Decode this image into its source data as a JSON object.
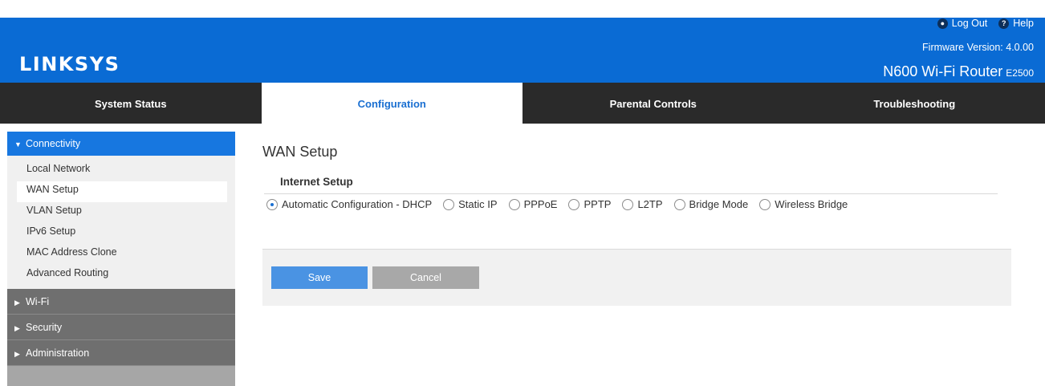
{
  "header": {
    "logo": "LINKSYS",
    "logout_label": "Log Out",
    "help_label": "Help",
    "firmware": "Firmware Version: 4.0.00",
    "model_name": "N600 Wi-Fi Router",
    "model_code": "E2500"
  },
  "tabs": [
    {
      "label": "System Status"
    },
    {
      "label": "Configuration"
    },
    {
      "label": "Parental Controls"
    },
    {
      "label": "Troubleshooting"
    }
  ],
  "sidebar": {
    "connectivity": "Connectivity",
    "items": [
      {
        "label": "Local Network"
      },
      {
        "label": "WAN Setup"
      },
      {
        "label": "VLAN Setup"
      },
      {
        "label": "IPv6 Setup"
      },
      {
        "label": "MAC Address Clone"
      },
      {
        "label": "Advanced Routing"
      }
    ],
    "groups": [
      {
        "label": "Wi-Fi"
      },
      {
        "label": "Security"
      },
      {
        "label": "Administration"
      }
    ]
  },
  "main": {
    "title": "WAN Setup",
    "section": "Internet Setup",
    "options": [
      {
        "label": "Automatic Configuration - DHCP"
      },
      {
        "label": "Static IP"
      },
      {
        "label": "PPPoE"
      },
      {
        "label": "PPTP"
      },
      {
        "label": "L2TP"
      },
      {
        "label": "Bridge Mode"
      },
      {
        "label": "Wireless Bridge"
      }
    ],
    "selected_option": "Automatic Configuration - DHCP",
    "save_label": "Save",
    "cancel_label": "Cancel"
  },
  "colors": {
    "brand_blue": "#0a6bd4",
    "tab_bar": "#2a2a2a",
    "active_tab_text": "#1a6fd1",
    "sidebar_active": "#1777e0",
    "save_button": "#4a93e3",
    "cancel_button": "#a8a8a8"
  },
  "icons": {
    "logout": "lock-icon",
    "help": "help-icon",
    "expanded": "caret-down-icon",
    "collapsed": "caret-right-icon"
  }
}
